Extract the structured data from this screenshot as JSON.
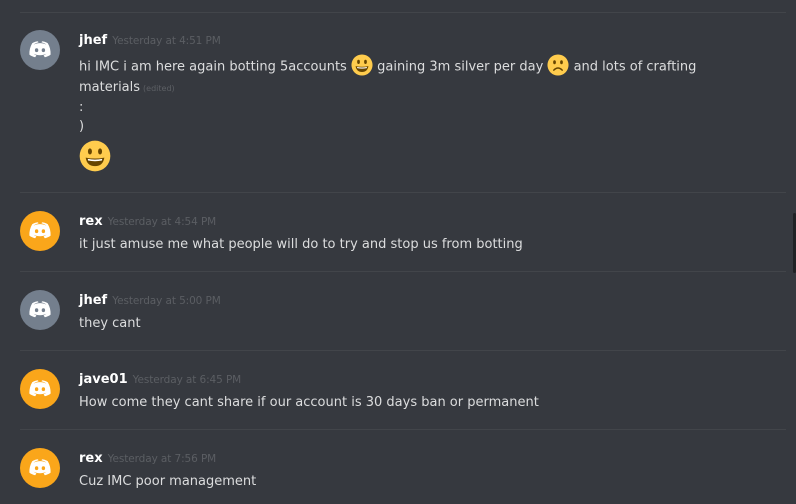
{
  "messages": [
    {
      "username": "jhef",
      "timestamp": "Yesterday at 4:51 PM",
      "avatar_color": "#747f8d",
      "text_part1": "hi IMC i am here again botting 5accounts",
      "text_part2": "gaining 3m silver per day",
      "text_part3": "and lots of crafting",
      "line2": "materials",
      "edited": "(edited)",
      "line3": ":",
      "line4": ")"
    },
    {
      "username": "rex",
      "timestamp": "Yesterday at 4:54 PM",
      "avatar_color": "#faa61a",
      "text": "it just amuse me what people will do to try and stop us from botting"
    },
    {
      "username": "jhef",
      "timestamp": "Yesterday at 5:00 PM",
      "avatar_color": "#747f8d",
      "text": "they cant"
    },
    {
      "username": "jave01",
      "timestamp": "Yesterday at 6:45 PM",
      "avatar_color": "#faa61a",
      "text": "How come they cant share if our account is 30 days ban or permanent"
    },
    {
      "username": "rex",
      "timestamp": "Yesterday at 7:56 PM",
      "avatar_color": "#faa61a",
      "text": "Cuz IMC poor management"
    }
  ],
  "icons": {
    "avatar": "discord-logo-icon",
    "smile": "smiley-emoji-icon",
    "frown": "frowning-emoji-icon"
  }
}
